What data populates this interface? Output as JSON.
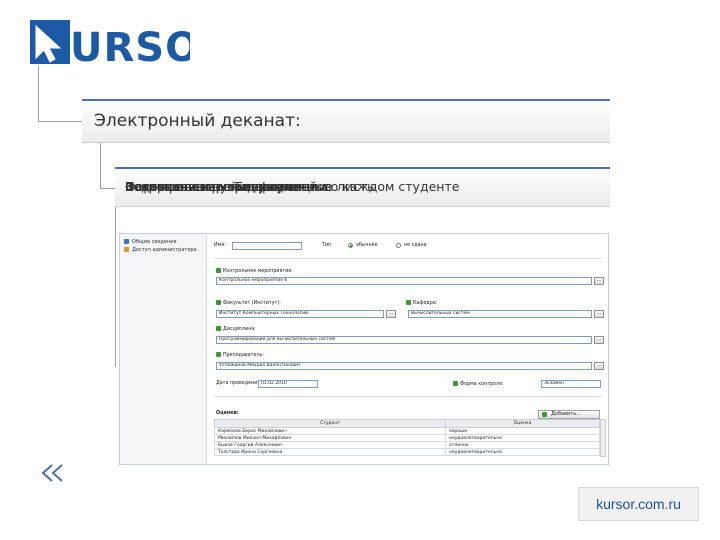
{
  "logo": {
    "text": "KURSOR"
  },
  "heading": {
    "text": "Электронный деканат:"
  },
  "subheading": {
    "layers": [
      "Формирование «Бегунков»",
      "Контрольные мероприятия",
      "Ведомости и экзаменационные листы",
      "Сохранение всей информации о каждом студенте",
      "Назначение преподавателей",
      "Печать и выгрузка документов"
    ]
  },
  "app": {
    "sidebar": {
      "items": [
        {
          "label": "Общие сведения",
          "icon": "info-icon"
        },
        {
          "label": "Доступ администратора",
          "icon": "admin-icon"
        }
      ]
    },
    "form": {
      "name_label": "Имя:",
      "type_label": "Тип",
      "type_options": [
        "обычное",
        "не сдана"
      ],
      "control_section_label": "Контрольное мероприятие:",
      "control_value": "Контрольное мероприятие 6",
      "faculty_label": "Факультет (Институт):",
      "faculty_value": "Институт Компьютерных Технологий",
      "department_label": "Кафедра:",
      "department_value": "Вычислительных систем",
      "discipline_label": "Дисциплина:",
      "discipline_value": "Программирование для вычислительных систем",
      "teacher_label": "Преподаватель:",
      "teacher_value": "Устюжанов Михаил Валентинович",
      "date_label": "Дата проведения:",
      "date_value": "01.02.2010",
      "control_form_label": "Форма контроля:",
      "control_form_value": "Экзамен",
      "grades_label": "Оценки:",
      "add_button": "Добавить...",
      "dots_label": "..."
    },
    "grades": {
      "columns": [
        "Студент",
        "Оценка"
      ],
      "rows": [
        [
          "Кармазов Борис Михайлович",
          "хорошо"
        ],
        [
          "Михайлов Михаил Михайлович",
          "неудовлетворительно"
        ],
        [
          "Быков Георгий Алексеевич",
          "отлично"
        ],
        [
          "Толстова Ирина Сергеевна",
          "неудовлетворительно"
        ]
      ]
    }
  },
  "footer": {
    "url": "kursor.com.ru"
  },
  "colors": {
    "brand": "#1d5aa6",
    "accent": "#4d6fb0",
    "connector": "#9aa0a6"
  }
}
